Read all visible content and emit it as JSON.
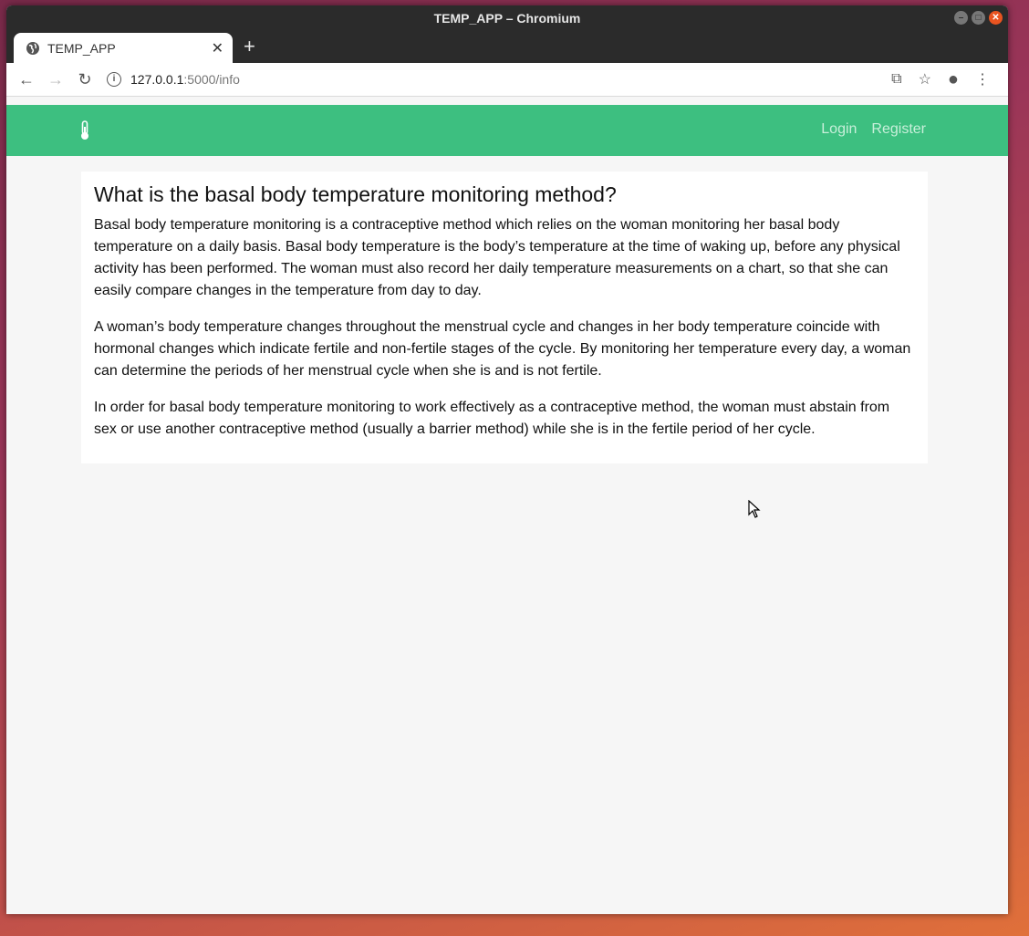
{
  "window": {
    "title": "TEMP_APP – Chromium"
  },
  "browser": {
    "tab_title": "TEMP_APP",
    "new_tab_label": "+",
    "url_host": "127.0.0.1",
    "url_path": ":5000/info"
  },
  "navbar": {
    "brand_icon": "thermometer-icon",
    "color": "#3dbf80",
    "links": [
      {
        "label": "Login"
      },
      {
        "label": "Register"
      }
    ]
  },
  "main": {
    "heading": "What is the basal body temperature monitoring method?",
    "paragraphs": [
      "Basal body temperature monitoring is a contraceptive method which relies on the woman monitoring her basal body temperature on a daily basis. Basal body temperature is the body’s temperature at the time of waking up, before any physical activity has been performed. The woman must also record her daily temperature measurements on a chart, so that she can easily compare changes in the temperature from day to day.",
      "A woman’s body temperature changes throughout the menstrual cycle and changes in her body temperature coincide with hormonal changes which indicate fertile and non-fertile stages of the cycle. By monitoring her temperature every day, a woman can determine the periods of her menstrual cycle when she is and is not fertile.",
      "In order for basal body temperature monitoring to work effectively as a contraceptive method, the woman must abstain from sex or use another contraceptive method (usually a barrier method) while she is in the fertile period of her cycle."
    ]
  }
}
